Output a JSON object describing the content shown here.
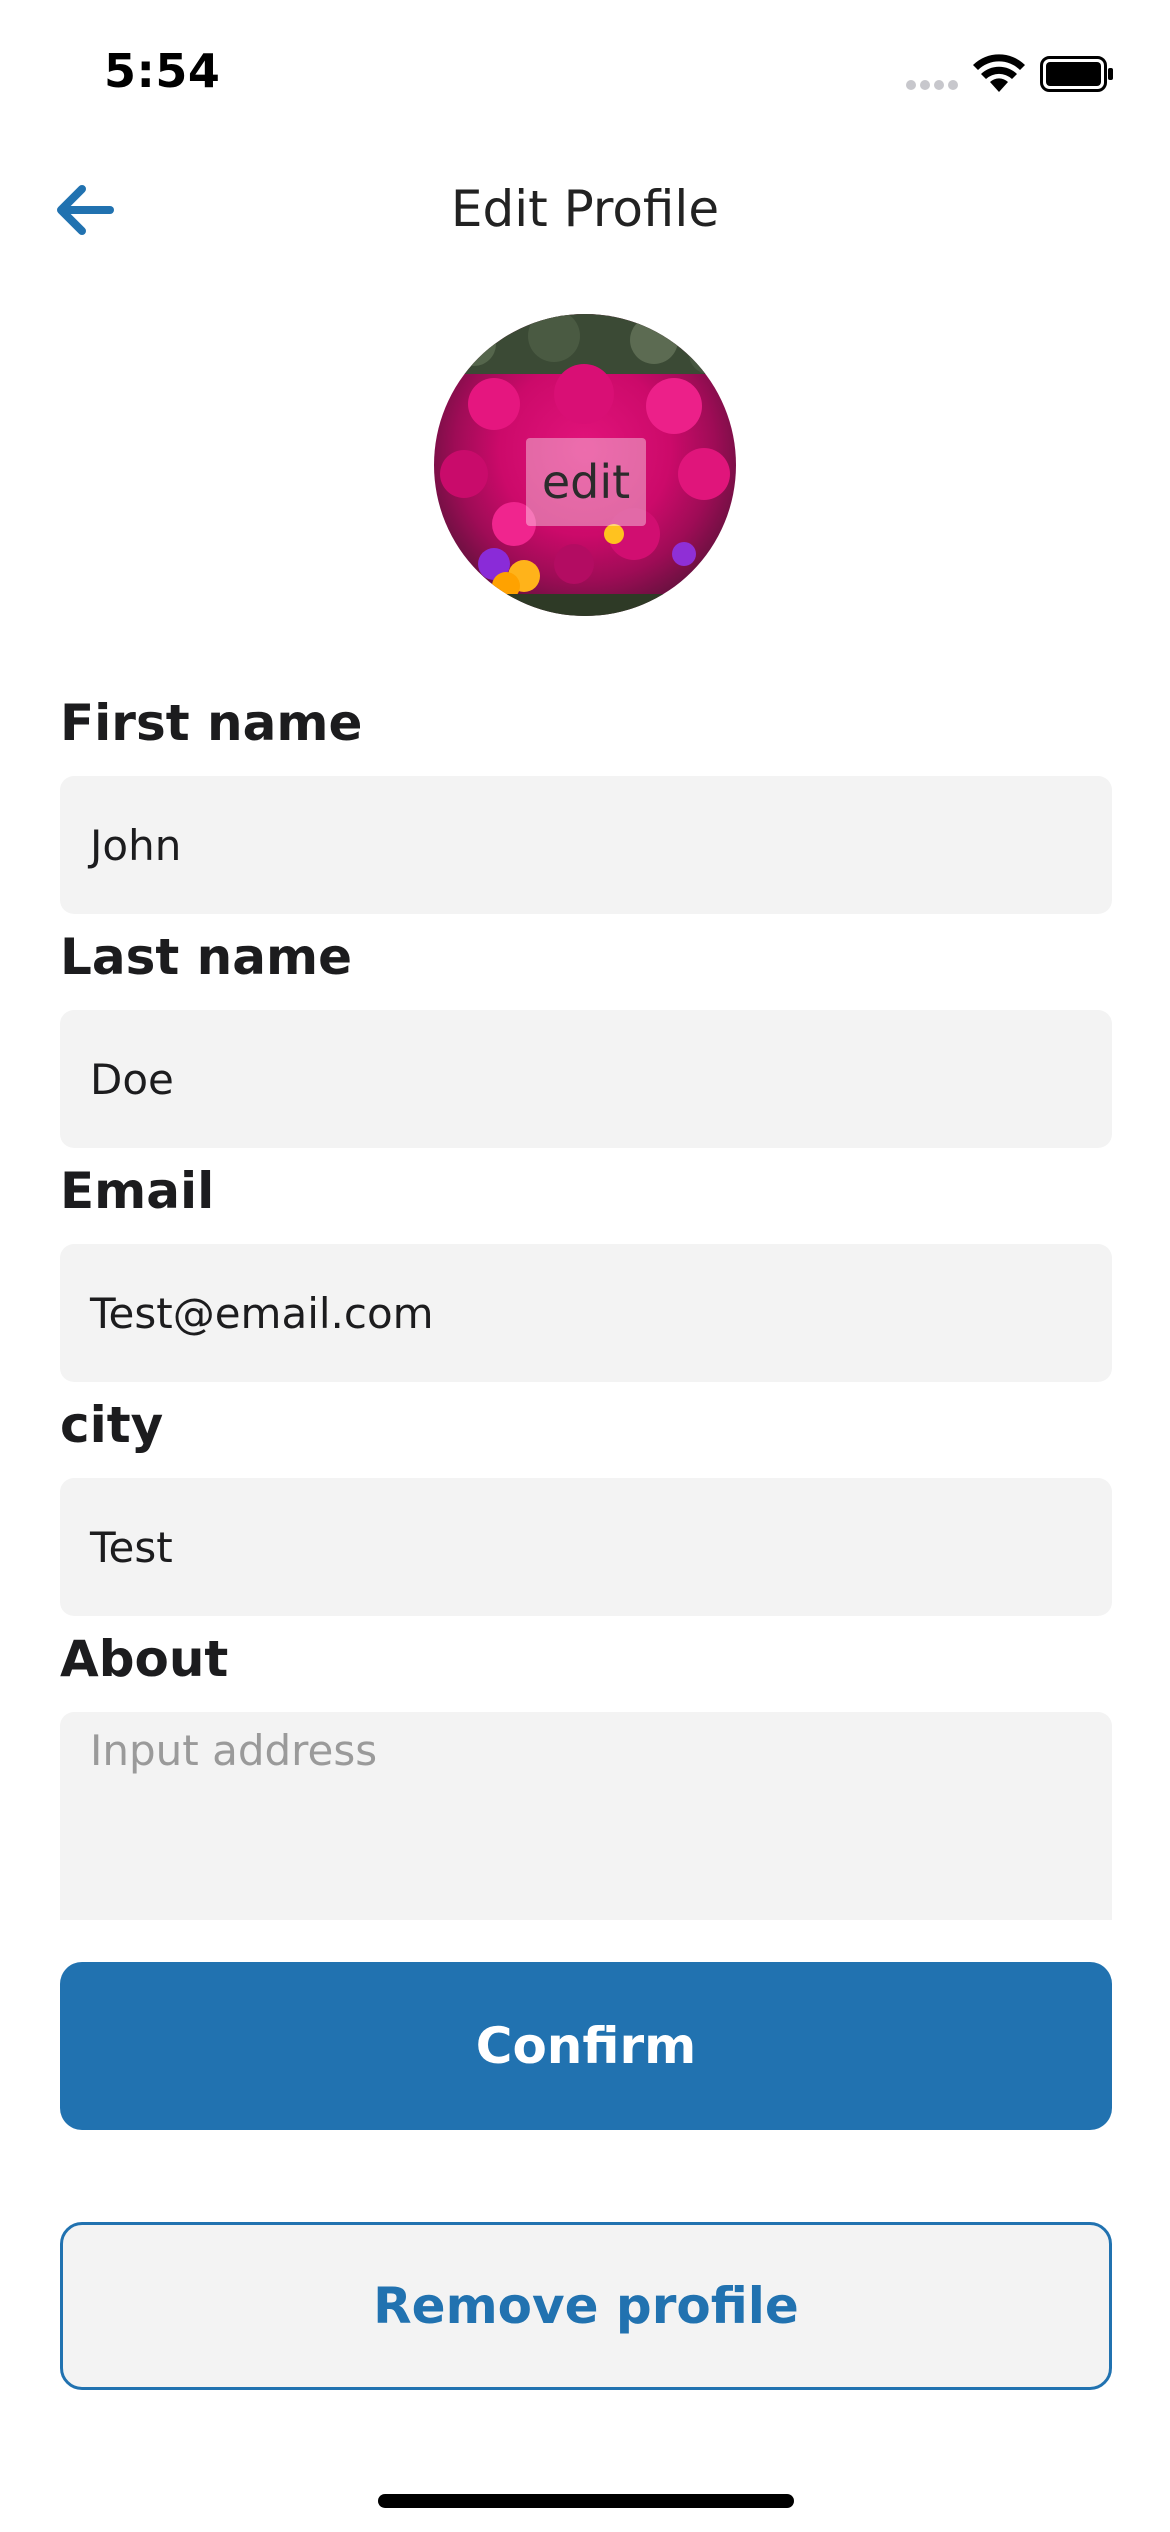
{
  "status_bar": {
    "time": "5:54",
    "signal_icon": "cellular-signal-icon",
    "wifi_icon": "wifi-icon",
    "battery_icon": "battery-icon"
  },
  "header": {
    "title": "Edit Profile",
    "back_icon": "back-arrow-icon",
    "accent_color": "#2172b0"
  },
  "avatar": {
    "edit_label": "edit"
  },
  "form": {
    "first_name": {
      "label": "First name",
      "value": "John"
    },
    "last_name": {
      "label": "Last name",
      "value": "Doe"
    },
    "email": {
      "label": "Email",
      "value": "Test@email.com"
    },
    "city": {
      "label": "city",
      "value": "Test"
    },
    "about": {
      "label": "About",
      "value": "",
      "placeholder": "Input address"
    }
  },
  "actions": {
    "confirm_label": "Confirm",
    "remove_label": "Remove profile",
    "primary_color": "#2172b0"
  }
}
